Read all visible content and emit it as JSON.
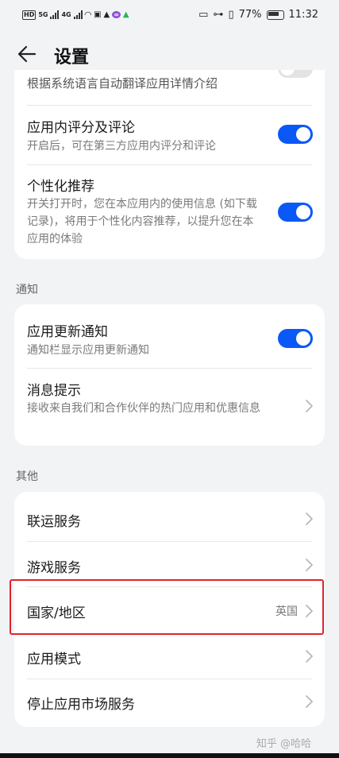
{
  "status_bar": {
    "left_labels": [
      "HD",
      "5G",
      "4G"
    ],
    "time": "11:32",
    "battery": "77%"
  },
  "header": {
    "title": "设置"
  },
  "card_top": {
    "partial_row_sub": "根据系统语言自动翻译应用详情介绍",
    "rows": [
      {
        "title": "应用内评分及评论",
        "sub": "开启后，可在第三方应用内评分和评论",
        "enabled": true
      },
      {
        "title": "个性化推荐",
        "sub": "开关打开时，您在本应用内的使用信息 (如下载记录)，将用于个性化内容推荐，以提升您在本应用的体验",
        "enabled": true
      }
    ]
  },
  "section_notify": {
    "label": "通知",
    "rows": [
      {
        "title": "应用更新通知",
        "sub": "通知栏显示应用更新通知",
        "enabled": true
      },
      {
        "title": "消息提示",
        "sub": "接收来自我们和合作伙伴的热门应用和优惠信息"
      }
    ]
  },
  "section_other": {
    "label": "其他",
    "rows": [
      {
        "title": "联运服务"
      },
      {
        "title": "游戏服务"
      },
      {
        "title": "国家/地区",
        "value": "英国"
      },
      {
        "title": "应用模式"
      },
      {
        "title": "停止应用市场服务"
      }
    ]
  },
  "watermark": "知乎 @哈哈",
  "colors": {
    "accent": "#0a59f7",
    "highlight": "#e0232b",
    "background": "#f1f3f5"
  }
}
